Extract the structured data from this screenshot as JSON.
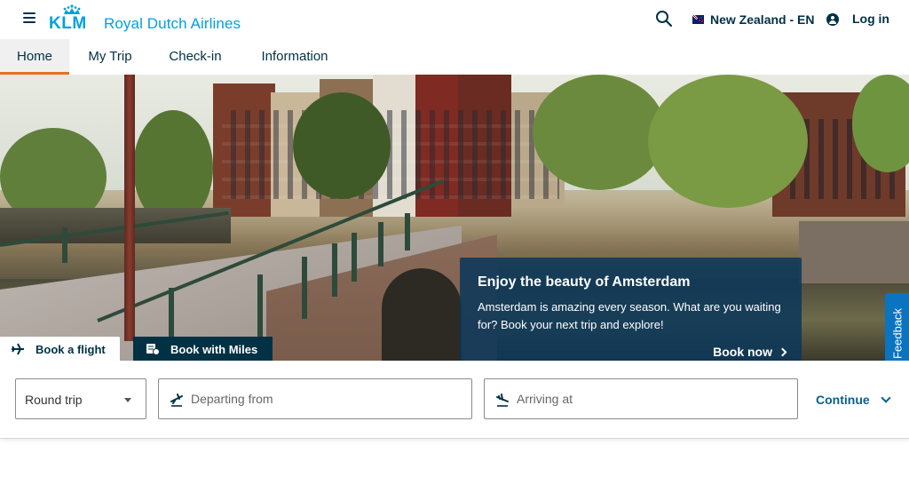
{
  "header": {
    "logo_text": "KLM",
    "brand_name": "Royal Dutch Airlines",
    "region_label": "New Zealand - EN",
    "login_label": "Log in",
    "icons": {
      "menu": "hamburger-menu-icon",
      "search": "search-icon",
      "flag": "new-zealand-flag-icon",
      "user": "user-account-icon"
    }
  },
  "nav": {
    "items": [
      {
        "label": "Home",
        "active": true
      },
      {
        "label": "My Trip",
        "active": false
      },
      {
        "label": "Check-in",
        "active": false
      },
      {
        "label": "Information",
        "active": false
      }
    ]
  },
  "promo": {
    "title": "Enjoy the beauty of Amsterdam",
    "body": "Amsterdam is amazing every season. What are you waiting for? Book your next trip and explore!",
    "cta_label": "Book now"
  },
  "feedback": {
    "label": "Feedback"
  },
  "booking": {
    "tabs": [
      {
        "label": "Book a flight",
        "active": true
      },
      {
        "label": "Book with Miles",
        "active": false
      }
    ],
    "trip_type": "Round trip",
    "departing_placeholder": "Departing from",
    "arriving_placeholder": "Arriving at",
    "continue_label": "Continue"
  },
  "colors": {
    "brand_blue": "#00a1de",
    "dark_blue": "#003145",
    "accent_orange": "#e37222",
    "link_blue": "#0b5e8f",
    "feedback_blue": "#0b74c0"
  }
}
